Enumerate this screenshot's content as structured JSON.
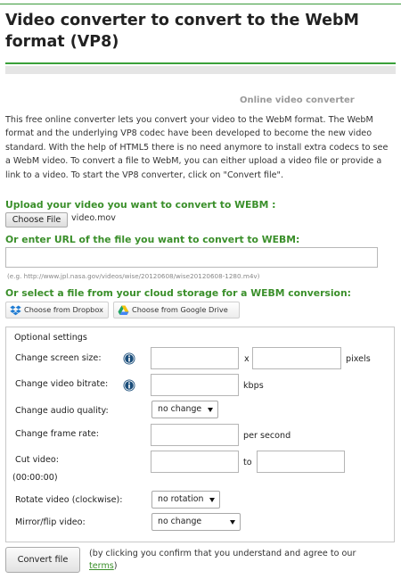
{
  "page": {
    "title": "Video converter to convert to the WebM format (VP8)",
    "subtitle": "Online video converter",
    "intro": "This free online converter lets you convert your video to the WebM format. The WebM format and the underlying VP8 codec have been developed to become the new video standard. With the help of HTML5 there is no need anymore to install extra codecs to see a WebM video. To convert a file to WebM, you can either upload a video file or provide a link to a video. To start the VP8 converter, click on \"Convert file\"."
  },
  "upload": {
    "heading": "Upload your video you want to convert to WEBM :",
    "choose_label": "Choose File",
    "file_name": "video.mov"
  },
  "url": {
    "heading": "Or enter URL of the file you want to convert to WEBM:",
    "value": "",
    "hint": "(e.g. http://www.jpl.nasa.gov/videos/wise/20120608/wise20120608-1280.m4v)"
  },
  "cloud": {
    "heading": "Or select a file from your cloud storage for a WEBM conversion:",
    "dropbox_label": "Choose from Dropbox",
    "gdrive_label": "Choose from Google Drive"
  },
  "settings": {
    "title": "Optional settings",
    "screen_size": {
      "label": "Change screen size:",
      "width": "",
      "separator": "x",
      "height": "",
      "unit": "pixels"
    },
    "bitrate": {
      "label": "Change video bitrate:",
      "value": "",
      "unit": "kbps"
    },
    "audio_quality": {
      "label": "Change audio quality:",
      "selected": "no change"
    },
    "frame_rate": {
      "label": "Change frame rate:",
      "value": "",
      "unit": "per second"
    },
    "cut": {
      "label": "Cut video:",
      "from": "",
      "to_label": "to",
      "to": "",
      "time_hint": "(00:00:00)"
    },
    "rotate": {
      "label": "Rotate video (clockwise):",
      "selected": "no rotation"
    },
    "mirror": {
      "label": "Mirror/flip video:",
      "selected": "no change"
    }
  },
  "actions": {
    "convert_label": "Convert file",
    "confirm_text": "(by clicking you confirm that you understand and agree to our ",
    "terms_label": "terms",
    "confirm_end": ")"
  },
  "colors": {
    "accent_green": "#3a8f2a",
    "rule_green": "#3aa03a",
    "info_icon": "#1a4d7a"
  }
}
